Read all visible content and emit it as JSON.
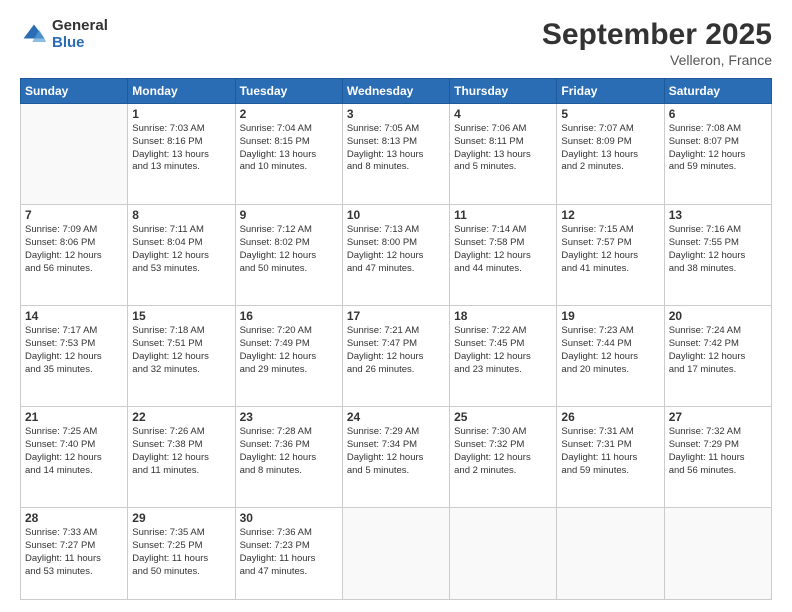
{
  "logo": {
    "general": "General",
    "blue": "Blue"
  },
  "title": {
    "month": "September 2025",
    "location": "Velleron, France"
  },
  "headers": [
    "Sunday",
    "Monday",
    "Tuesday",
    "Wednesday",
    "Thursday",
    "Friday",
    "Saturday"
  ],
  "rows": [
    [
      {
        "day": "",
        "info": ""
      },
      {
        "day": "1",
        "info": "Sunrise: 7:03 AM\nSunset: 8:16 PM\nDaylight: 13 hours\nand 13 minutes."
      },
      {
        "day": "2",
        "info": "Sunrise: 7:04 AM\nSunset: 8:15 PM\nDaylight: 13 hours\nand 10 minutes."
      },
      {
        "day": "3",
        "info": "Sunrise: 7:05 AM\nSunset: 8:13 PM\nDaylight: 13 hours\nand 8 minutes."
      },
      {
        "day": "4",
        "info": "Sunrise: 7:06 AM\nSunset: 8:11 PM\nDaylight: 13 hours\nand 5 minutes."
      },
      {
        "day": "5",
        "info": "Sunrise: 7:07 AM\nSunset: 8:09 PM\nDaylight: 13 hours\nand 2 minutes."
      },
      {
        "day": "6",
        "info": "Sunrise: 7:08 AM\nSunset: 8:07 PM\nDaylight: 12 hours\nand 59 minutes."
      }
    ],
    [
      {
        "day": "7",
        "info": "Sunrise: 7:09 AM\nSunset: 8:06 PM\nDaylight: 12 hours\nand 56 minutes."
      },
      {
        "day": "8",
        "info": "Sunrise: 7:11 AM\nSunset: 8:04 PM\nDaylight: 12 hours\nand 53 minutes."
      },
      {
        "day": "9",
        "info": "Sunrise: 7:12 AM\nSunset: 8:02 PM\nDaylight: 12 hours\nand 50 minutes."
      },
      {
        "day": "10",
        "info": "Sunrise: 7:13 AM\nSunset: 8:00 PM\nDaylight: 12 hours\nand 47 minutes."
      },
      {
        "day": "11",
        "info": "Sunrise: 7:14 AM\nSunset: 7:58 PM\nDaylight: 12 hours\nand 44 minutes."
      },
      {
        "day": "12",
        "info": "Sunrise: 7:15 AM\nSunset: 7:57 PM\nDaylight: 12 hours\nand 41 minutes."
      },
      {
        "day": "13",
        "info": "Sunrise: 7:16 AM\nSunset: 7:55 PM\nDaylight: 12 hours\nand 38 minutes."
      }
    ],
    [
      {
        "day": "14",
        "info": "Sunrise: 7:17 AM\nSunset: 7:53 PM\nDaylight: 12 hours\nand 35 minutes."
      },
      {
        "day": "15",
        "info": "Sunrise: 7:18 AM\nSunset: 7:51 PM\nDaylight: 12 hours\nand 32 minutes."
      },
      {
        "day": "16",
        "info": "Sunrise: 7:20 AM\nSunset: 7:49 PM\nDaylight: 12 hours\nand 29 minutes."
      },
      {
        "day": "17",
        "info": "Sunrise: 7:21 AM\nSunset: 7:47 PM\nDaylight: 12 hours\nand 26 minutes."
      },
      {
        "day": "18",
        "info": "Sunrise: 7:22 AM\nSunset: 7:45 PM\nDaylight: 12 hours\nand 23 minutes."
      },
      {
        "day": "19",
        "info": "Sunrise: 7:23 AM\nSunset: 7:44 PM\nDaylight: 12 hours\nand 20 minutes."
      },
      {
        "day": "20",
        "info": "Sunrise: 7:24 AM\nSunset: 7:42 PM\nDaylight: 12 hours\nand 17 minutes."
      }
    ],
    [
      {
        "day": "21",
        "info": "Sunrise: 7:25 AM\nSunset: 7:40 PM\nDaylight: 12 hours\nand 14 minutes."
      },
      {
        "day": "22",
        "info": "Sunrise: 7:26 AM\nSunset: 7:38 PM\nDaylight: 12 hours\nand 11 minutes."
      },
      {
        "day": "23",
        "info": "Sunrise: 7:28 AM\nSunset: 7:36 PM\nDaylight: 12 hours\nand 8 minutes."
      },
      {
        "day": "24",
        "info": "Sunrise: 7:29 AM\nSunset: 7:34 PM\nDaylight: 12 hours\nand 5 minutes."
      },
      {
        "day": "25",
        "info": "Sunrise: 7:30 AM\nSunset: 7:32 PM\nDaylight: 12 hours\nand 2 minutes."
      },
      {
        "day": "26",
        "info": "Sunrise: 7:31 AM\nSunset: 7:31 PM\nDaylight: 11 hours\nand 59 minutes."
      },
      {
        "day": "27",
        "info": "Sunrise: 7:32 AM\nSunset: 7:29 PM\nDaylight: 11 hours\nand 56 minutes."
      }
    ],
    [
      {
        "day": "28",
        "info": "Sunrise: 7:33 AM\nSunset: 7:27 PM\nDaylight: 11 hours\nand 53 minutes."
      },
      {
        "day": "29",
        "info": "Sunrise: 7:35 AM\nSunset: 7:25 PM\nDaylight: 11 hours\nand 50 minutes."
      },
      {
        "day": "30",
        "info": "Sunrise: 7:36 AM\nSunset: 7:23 PM\nDaylight: 11 hours\nand 47 minutes."
      },
      {
        "day": "",
        "info": ""
      },
      {
        "day": "",
        "info": ""
      },
      {
        "day": "",
        "info": ""
      },
      {
        "day": "",
        "info": ""
      }
    ]
  ]
}
